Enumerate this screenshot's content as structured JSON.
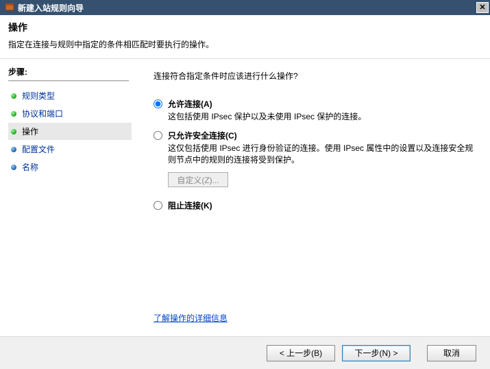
{
  "window": {
    "title": "新建入站规则向导"
  },
  "header": {
    "title": "操作",
    "subtitle": "指定在连接与规则中指定的条件相匹配时要执行的操作。"
  },
  "sidebar": {
    "title": "步骤:",
    "items": [
      {
        "label": "规则类型",
        "active": false
      },
      {
        "label": "协议和端口",
        "active": false
      },
      {
        "label": "操作",
        "active": true
      },
      {
        "label": "配置文件",
        "active": false
      },
      {
        "label": "名称",
        "active": false
      }
    ]
  },
  "content": {
    "question": "连接符合指定条件时应该进行什么操作?",
    "options": [
      {
        "title": "允许连接(A)",
        "desc": "这包括使用 IPsec 保护以及未使用 IPsec 保护的连接。",
        "selected": true
      },
      {
        "title": "只允许安全连接(C)",
        "desc": "这仅包括使用 IPsec 进行身份验证的连接。使用 IPsec 属性中的设置以及连接安全规则节点中的规则的连接将受到保护。",
        "selected": false,
        "custom_button": "自定义(Z)..."
      },
      {
        "title": "阻止连接(K)",
        "desc": "",
        "selected": false
      }
    ],
    "learn_more": "了解操作的详细信息"
  },
  "footer": {
    "back": "< 上一步(B)",
    "next": "下一步(N) >",
    "cancel": "取消"
  }
}
